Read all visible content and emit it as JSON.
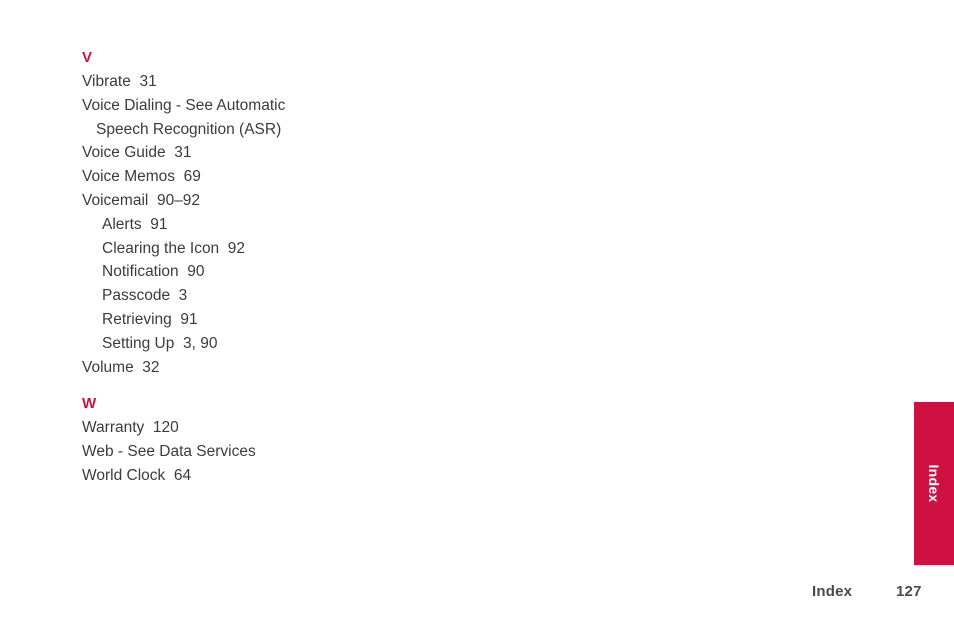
{
  "document": {
    "type": "index",
    "colors": {
      "accent": "#ce1141",
      "body_text": "#3c3c3c",
      "footer_text": "#4a4a4a",
      "page_background": "#ffffff",
      "tab_text": "#ffffff"
    }
  },
  "sections": [
    {
      "letter": "V",
      "entries": [
        {
          "text": "Vibrate  31",
          "level": 0
        },
        {
          "text": "Voice Dialing - See Automatic",
          "level": 0
        },
        {
          "text": "Speech Recognition (ASR)",
          "level": "cont"
        },
        {
          "text": "Voice Guide  31",
          "level": 0
        },
        {
          "text": "Voice Memos  69",
          "level": 0
        },
        {
          "text": "Voicemail  90–92",
          "level": 0
        },
        {
          "text": "Alerts  91",
          "level": 1
        },
        {
          "text": "Clearing the Icon  92",
          "level": 1
        },
        {
          "text": "Notification  90",
          "level": 1
        },
        {
          "text": "Passcode  3",
          "level": 1
        },
        {
          "text": "Retrieving  91",
          "level": 1
        },
        {
          "text": "Setting Up  3, 90",
          "level": 1
        },
        {
          "text": "Volume  32",
          "level": 0
        }
      ]
    },
    {
      "letter": "W",
      "entries": [
        {
          "text": "Warranty  120",
          "level": 0
        },
        {
          "text": "Web - See Data Services",
          "level": 0
        },
        {
          "text": "World Clock  64",
          "level": 0
        }
      ]
    }
  ],
  "side_tab": {
    "label": "Index"
  },
  "footer": {
    "label": "Index",
    "page_number": "127"
  }
}
